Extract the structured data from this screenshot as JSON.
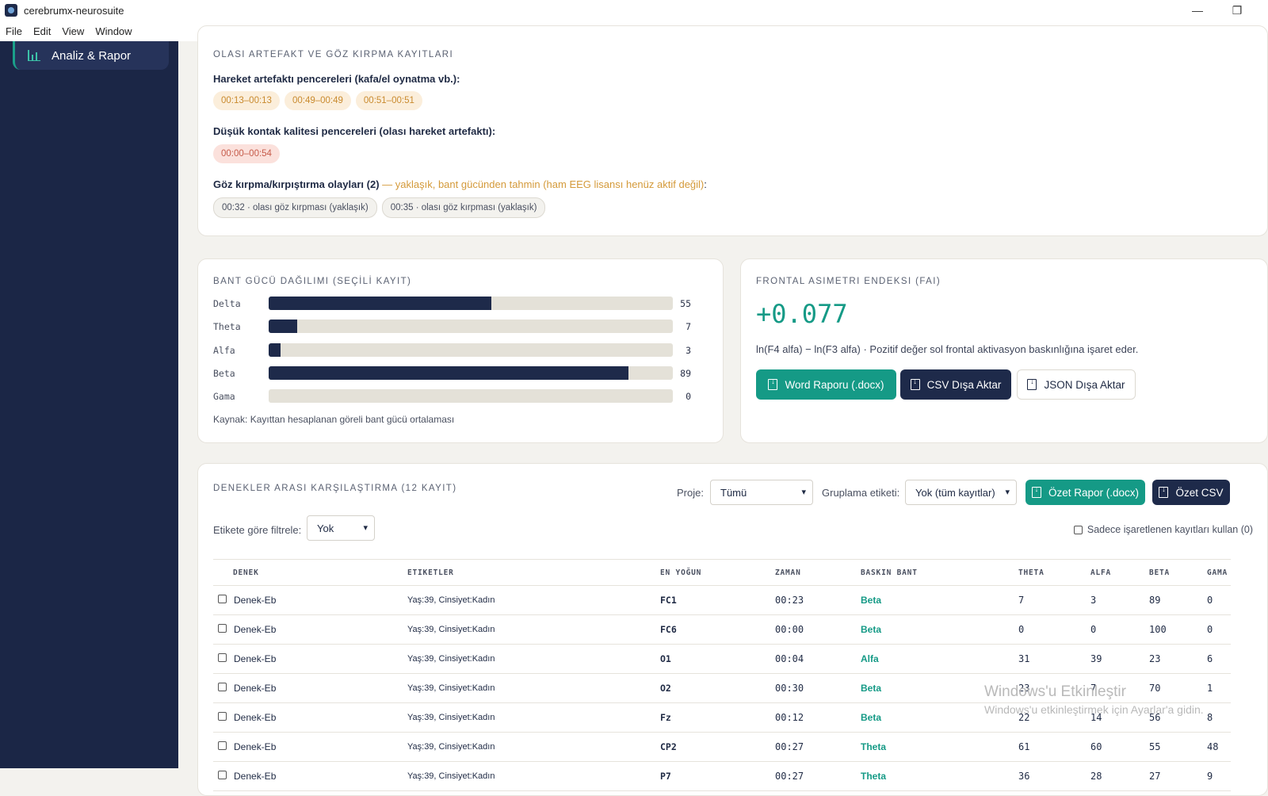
{
  "window": {
    "title": "cerebrumx-neurosuite",
    "minimize": "—",
    "restore": "❐"
  },
  "menu": [
    "File",
    "Edit",
    "View",
    "Window"
  ],
  "sidebar": {
    "active_item": "Analiz & Rapor"
  },
  "artifacts": {
    "title": "OLASI ARTEFAKT VE GÖZ KIRPMA KAYITLARI",
    "motion_label": "Hareket artefaktı pencereleri (kafa/el oynatma vb.):",
    "motion_windows": [
      "00:13–00:13",
      "00:49–00:49",
      "00:51–00:51"
    ],
    "contact_label": "Düşük kontak kalitesi pencereleri (olası hareket artefaktı):",
    "contact_windows": [
      "00:00–00:54"
    ],
    "blink_label": "Göz kırpma/kırpıştırma olayları (2)",
    "blink_note": "— yaklaşık, bant gücünden tahmin (ham EEG lisansı henüz aktif değil)",
    "blink_suffix": ":",
    "blink_events": [
      "00:32 · olası göz kırpması (yaklaşık)",
      "00:35 · olası göz kırpması (yaklaşık)"
    ]
  },
  "band_power": {
    "title": "BANT GÜCÜ DAĞILIMI (SEÇİLİ KAYIT)",
    "source": "Kaynak: Kayıttan hesaplanan göreli bant gücü ortalaması"
  },
  "chart_data": {
    "type": "bar",
    "categories": [
      "Delta",
      "Theta",
      "Alfa",
      "Beta",
      "Gama"
    ],
    "values": [
      55,
      7,
      3,
      89,
      0
    ],
    "ylim": [
      0,
      100
    ],
    "title": "BANT GÜCÜ DAĞILIMI (SEÇİLİ KAYIT)"
  },
  "fai": {
    "title": "FRONTAL ASIMETRI ENDEKSI (FAI)",
    "value": "+0.077",
    "description": "ln(F4 alfa) − ln(F3 alfa) · Pozitif değer sol frontal aktivasyon baskınlığına işaret eder.",
    "word_button": "Word Raporu (.docx)",
    "csv_button": "CSV Dışa Aktar",
    "json_button": "JSON Dışa Aktar"
  },
  "comparison": {
    "title": "DENEKLER ARASI KARŞILAŞTIRMA (12 KAYIT)",
    "project_label": "Proje:",
    "project_value": "Tümü",
    "group_label": "Gruplama etiketi:",
    "group_value": "Yok (tüm kayıtlar)",
    "summary_report_button": "Özet Rapor (.docx)",
    "summary_csv_button": "Özet CSV",
    "filter_label": "Etikete göre filtrele:",
    "filter_value": "Yok",
    "only_marked_label": "Sadece işaretlenen kayıtları kullan (0)",
    "columns": [
      "DENEK",
      "ETIKETLER",
      "EN YOĞUN",
      "ZAMAN",
      "BASKIN BANT",
      "THETA",
      "ALFA",
      "BETA",
      "GAMA"
    ],
    "rows": [
      {
        "subject": "Denek-Eb",
        "tags": "Yaş:39, Cinsiyet:Kadın",
        "peak": "FC1",
        "time": "00:23",
        "band": "Beta",
        "theta": "7",
        "alfa": "3",
        "beta": "89",
        "gama": "0"
      },
      {
        "subject": "Denek-Eb",
        "tags": "Yaş:39, Cinsiyet:Kadın",
        "peak": "FC6",
        "time": "00:00",
        "band": "Beta",
        "theta": "0",
        "alfa": "0",
        "beta": "100",
        "gama": "0"
      },
      {
        "subject": "Denek-Eb",
        "tags": "Yaş:39, Cinsiyet:Kadın",
        "peak": "O1",
        "time": "00:04",
        "band": "Alfa",
        "theta": "31",
        "alfa": "39",
        "beta": "23",
        "gama": "6"
      },
      {
        "subject": "Denek-Eb",
        "tags": "Yaş:39, Cinsiyet:Kadın",
        "peak": "O2",
        "time": "00:30",
        "band": "Beta",
        "theta": "23",
        "alfa": "7",
        "beta": "70",
        "gama": "1"
      },
      {
        "subject": "Denek-Eb",
        "tags": "Yaş:39, Cinsiyet:Kadın",
        "peak": "Fz",
        "time": "00:12",
        "band": "Beta",
        "theta": "22",
        "alfa": "14",
        "beta": "56",
        "gama": "8"
      },
      {
        "subject": "Denek-Eb",
        "tags": "Yaş:39, Cinsiyet:Kadın",
        "peak": "CP2",
        "time": "00:27",
        "band": "Theta",
        "theta": "61",
        "alfa": "60",
        "beta": "55",
        "gama": "48"
      },
      {
        "subject": "Denek-Eb",
        "tags": "Yaş:39, Cinsiyet:Kadın",
        "peak": "P7",
        "time": "00:27",
        "band": "Theta",
        "theta": "36",
        "alfa": "28",
        "beta": "27",
        "gama": "9"
      }
    ]
  },
  "watermark": {
    "line1": "Windows'u Etkinleştir",
    "line2": "Windows'u etkinleştirmek için Ayarlar'a gidin."
  }
}
